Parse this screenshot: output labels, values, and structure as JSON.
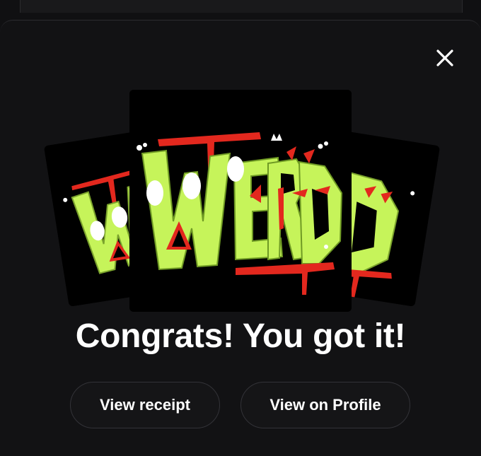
{
  "dialog": {
    "headline": "Congrats! You got it!",
    "close_icon": "close-icon"
  },
  "artwork": {
    "word": "WERD",
    "description_icon": "nft-artwork",
    "colors": {
      "letters": "#c6f45a",
      "accent": "#e3281e",
      "background": "#000000"
    }
  },
  "actions": {
    "receipt_label": "View receipt",
    "profile_label": "View on Profile"
  }
}
